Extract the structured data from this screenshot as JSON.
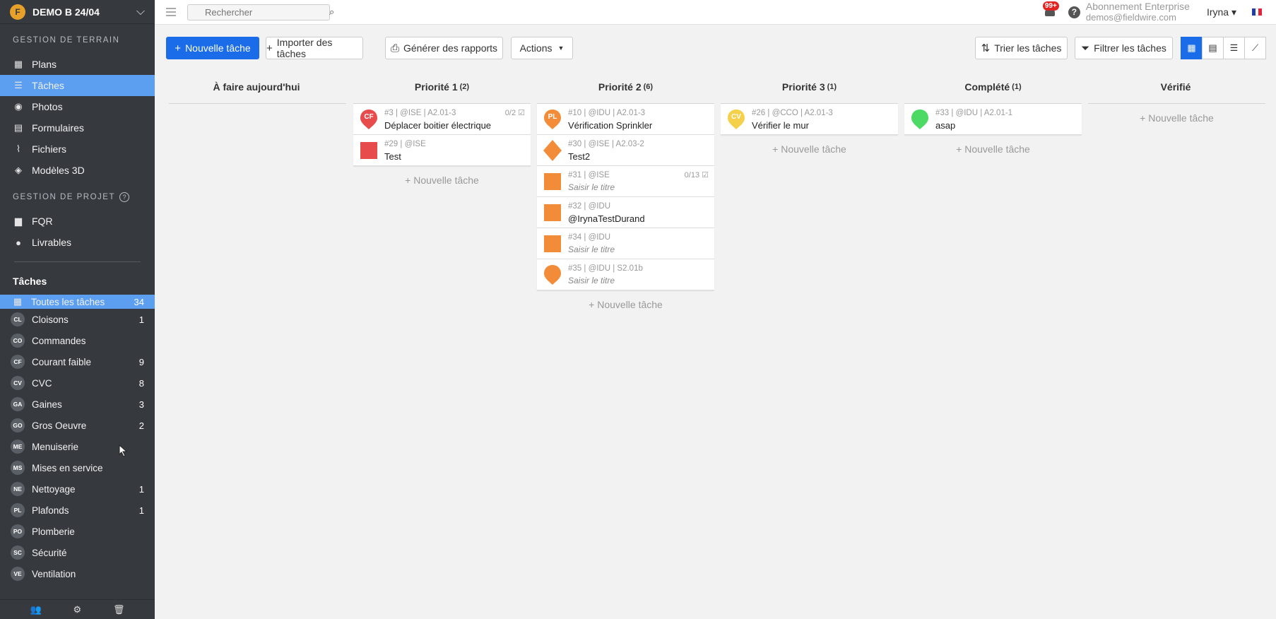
{
  "project": {
    "name": "DEMO B 24/04",
    "logo_letter": "F"
  },
  "sidebar": {
    "section_field": "GESTION DE TERRAIN",
    "field_items": [
      {
        "label": "Plans",
        "icon": "plans-icon"
      },
      {
        "label": "Tâches",
        "icon": "tasks-grid-icon"
      },
      {
        "label": "Photos",
        "icon": "camera-icon"
      },
      {
        "label": "Formulaires",
        "icon": "clipboard-icon"
      },
      {
        "label": "Fichiers",
        "icon": "paperclip-icon"
      },
      {
        "label": "Modèles 3D",
        "icon": "cube-icon"
      }
    ],
    "section_project": "GESTION DE PROJET",
    "project_items": [
      {
        "label": "FQR",
        "icon": "document-icon"
      },
      {
        "label": "Livrables",
        "icon": "user-stamp-icon"
      }
    ],
    "tasks_title": "Tâches",
    "categories": [
      {
        "abbr": "",
        "label": "Toutes les tâches",
        "count": "34"
      },
      {
        "abbr": "CL",
        "label": "Cloisons",
        "count": "1"
      },
      {
        "abbr": "CO",
        "label": "Commandes",
        "count": ""
      },
      {
        "abbr": "CF",
        "label": "Courant faible",
        "count": "9"
      },
      {
        "abbr": "CV",
        "label": "CVC",
        "count": "8"
      },
      {
        "abbr": "GA",
        "label": "Gaines",
        "count": "3"
      },
      {
        "abbr": "GO",
        "label": "Gros Oeuvre",
        "count": "2"
      },
      {
        "abbr": "ME",
        "label": "Menuiserie",
        "count": ""
      },
      {
        "abbr": "MS",
        "label": "Mises en service",
        "count": ""
      },
      {
        "abbr": "NE",
        "label": "Nettoyage",
        "count": "1"
      },
      {
        "abbr": "PL",
        "label": "Plafonds",
        "count": "1"
      },
      {
        "abbr": "PO",
        "label": "Plomberie",
        "count": ""
      },
      {
        "abbr": "SC",
        "label": "Sécurité",
        "count": ""
      },
      {
        "abbr": "VE",
        "label": "Ventilation",
        "count": ""
      }
    ]
  },
  "topbar": {
    "search_placeholder": "Rechercher",
    "notif_count": "99+",
    "help": "?",
    "plan_name": "Abonnement Enterprise",
    "email": "demos@fieldwire.com",
    "user": "Iryna ▾"
  },
  "toolbar": {
    "new_task": "Nouvelle tâche",
    "import": "Importer des tâches",
    "reports": "Générer des rapports",
    "actions": "Actions",
    "sort": "Trier les tâches",
    "filter": "Filtrer les tâches"
  },
  "board": {
    "add_task": "+ Nouvelle tâche",
    "columns": [
      {
        "title": "À faire aujourd'hui",
        "count": "",
        "cards": []
      },
      {
        "title": "Priorité 1",
        "count": "(2)",
        "cards": [
          {
            "meta": "#3 | @ISE | A2.01-3",
            "title": "Déplacer boitier électrique",
            "placeholder": false,
            "check": "0/2 ☑",
            "shape": "pin",
            "color": "#e84b4b",
            "label": "CF"
          },
          {
            "meta": "#29 | @ISE",
            "title": "Test",
            "placeholder": false,
            "check": "",
            "shape": "square",
            "color": "#e84b4b",
            "label": ""
          }
        ]
      },
      {
        "title": "Priorité 2",
        "count": "(6)",
        "cards": [
          {
            "meta": "#10 | @IDU | A2.01-3",
            "title": "Vérification Sprinkler",
            "placeholder": false,
            "check": "",
            "shape": "pin",
            "color": "#f28c38",
            "label": "PL"
          },
          {
            "meta": "#30 | @ISE | A2.03-2",
            "title": "Test2",
            "placeholder": false,
            "check": "",
            "shape": "diamond",
            "color": "#f28c38",
            "label": ""
          },
          {
            "meta": "#31 | @ISE",
            "title": "Saisir le titre",
            "placeholder": true,
            "check": "0/13 ☑",
            "shape": "square",
            "color": "#f28c38",
            "label": ""
          },
          {
            "meta": "#32 | @IDU",
            "title": "@IrynaTestDurand",
            "placeholder": false,
            "check": "",
            "shape": "square",
            "color": "#f28c38",
            "label": ""
          },
          {
            "meta": "#34 | @IDU",
            "title": "Saisir le titre",
            "placeholder": true,
            "check": "",
            "shape": "square",
            "color": "#f28c38",
            "label": ""
          },
          {
            "meta": "#35 | @IDU | S2.01b",
            "title": "Saisir le titre",
            "placeholder": true,
            "check": "",
            "shape": "pin",
            "color": "#f28c38",
            "label": ""
          }
        ]
      },
      {
        "title": "Priorité 3",
        "count": "(1)",
        "cards": [
          {
            "meta": "#26 | @CCO | A2.01-3",
            "title": "Vérifier le mur",
            "placeholder": false,
            "check": "",
            "shape": "pin",
            "color": "#f5d04a",
            "label": "CV"
          }
        ]
      },
      {
        "title": "Complété",
        "count": "(1)",
        "cards": [
          {
            "meta": "#33 | @IDU | A2.01-1",
            "title": "asap",
            "placeholder": false,
            "check": "",
            "shape": "pin",
            "color": "#4cd964",
            "label": ""
          }
        ]
      },
      {
        "title": "Vérifié",
        "count": "",
        "cards": []
      }
    ]
  },
  "colors": {
    "sidebar_bg": "#363a3f",
    "accent": "#1a6ce8",
    "active_item": "#5c9ff0"
  }
}
